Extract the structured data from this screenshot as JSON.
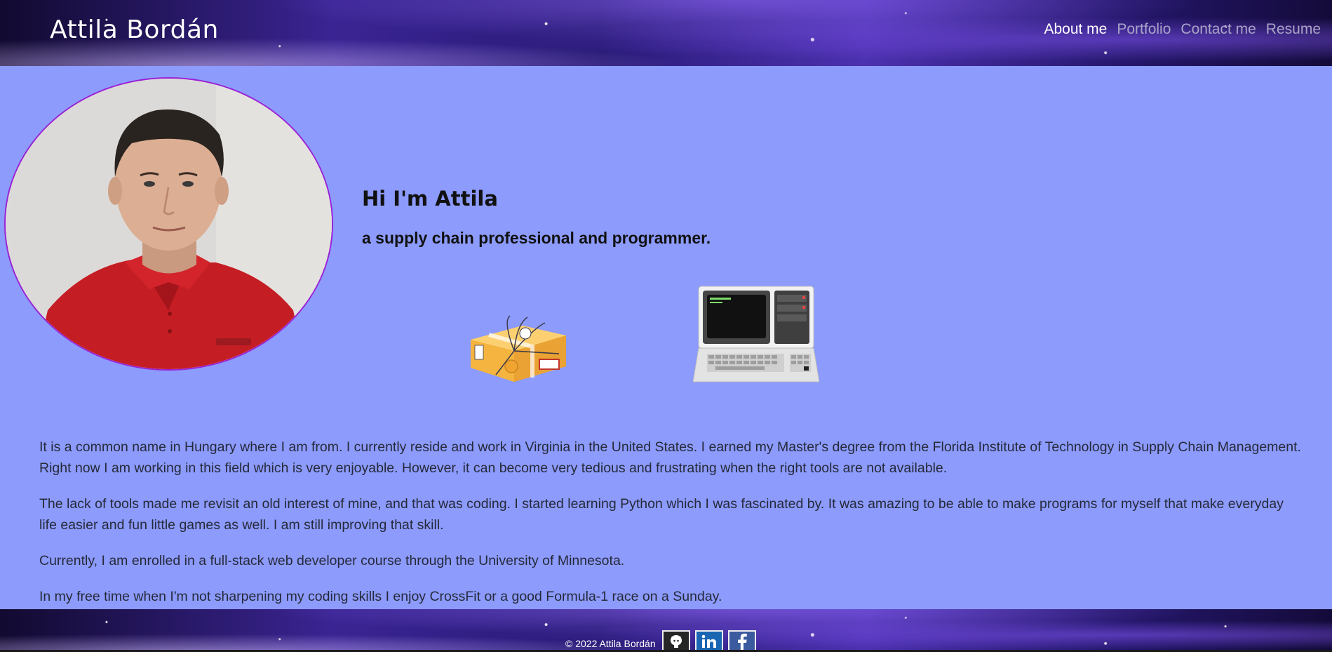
{
  "header": {
    "brand": "Attila Bordán",
    "nav": [
      {
        "label": "About me",
        "active": true
      },
      {
        "label": "Portfolio",
        "active": false
      },
      {
        "label": "Contact me",
        "active": false
      },
      {
        "label": "Resume",
        "active": false
      }
    ]
  },
  "hero": {
    "photo_icon": "profile-photo",
    "title": "Hi I'm Attila",
    "subtitle": "a supply chain professional and programmer.",
    "illustrations": [
      "package-box-illustration",
      "retro-computer-illustration"
    ]
  },
  "about": {
    "paragraphs": [
      "It is a common name in Hungary where I am from. I currently reside and work in Virginia in the United States. I earned my Master's degree from the Florida Institute of Technology in Supply Chain Management. Right now I am working in this field which is very enjoyable. However, it can become very tedious and frustrating when the right tools are not available.",
      "The lack of tools made me revisit an old interest of mine, and that was coding. I started learning Python which I was fascinated by. It was amazing to be able to make programs for myself that make everyday life easier and fun little games as well. I am still improving that skill.",
      "Currently, I am enrolled in a full-stack web developer course through the University of Minnesota.",
      "In my free time when I'm not sharpening my coding skills I enjoy CrossFit or a good Formula-1 race on a Sunday."
    ]
  },
  "footer": {
    "copyright": "© 2022 Attila Bordán",
    "social": [
      "github-icon",
      "linkedin-icon",
      "facebook-icon"
    ]
  },
  "colors": {
    "page_background": "#8c9bfc",
    "photo_border": "#9a21d6",
    "nav_active": "#ffffff",
    "nav_inactive": "#a9a4c8",
    "body_text": "#262a3a"
  }
}
